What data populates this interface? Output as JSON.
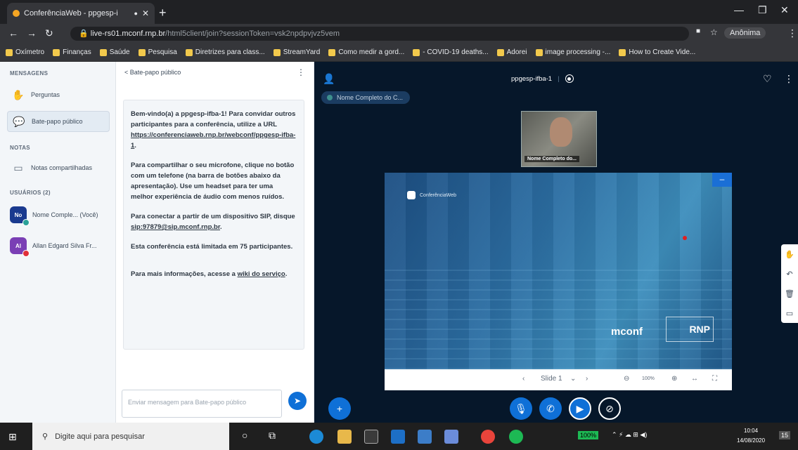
{
  "browser": {
    "tab_title": "ConferênciaWeb - ppgesp-i",
    "new_tab": "+",
    "url_host": "live-rs01.mconf.rnp.br",
    "url_path": "/html5client/join?sessionToken=vsk2npdpvjvz5vem",
    "profile": "Anônima",
    "bookmarks": [
      "Oxímetro",
      "Finanças",
      "Saúde",
      "Pesquisa",
      "Diretrizes para class...",
      "StreamYard",
      "Como medir a gord...",
      "- COVID-19 deaths...",
      "Adorei",
      "image processing -...",
      "How to Create Vide..."
    ]
  },
  "sidebar": {
    "messages_title": "MENSAGENS",
    "questions": "Perguntas",
    "public_chat": "Bate-papo público",
    "notes_title": "NOTAS",
    "shared_notes": "Notas compartilhadas",
    "users_title": "USUÁRIOS (2)",
    "users": [
      {
        "initials": "No",
        "name": "Nome Comple... (Você)",
        "color": "#1a3a8f",
        "status_color": "#2aa198"
      },
      {
        "initials": "Al",
        "name": "Allan Edgard Silva Fr...",
        "color": "#7a3fb5",
        "status_color": "#e0303a"
      }
    ]
  },
  "chat": {
    "header": "< Bate-papo público",
    "welcome_p1": "Bem-vindo(a) a ppgesp-ifba-1! Para convidar outros participantes para a conferência, utilize a URL",
    "welcome_url": "https://conferenciaweb.rnp.br/webconf/ppgesp-ifba-1",
    "welcome_p2": "Para compartilhar o seu microfone, clique no botão com um telefone (na barra de botões abaixo da apresentação). Use um headset para ter uma melhor experiência de áudio com menos ruídos.",
    "welcome_p3_prefix": "Para conectar a partir de um dispositivo SIP, disque",
    "welcome_sip": "sip:97879@sip.mconf.rnp.br",
    "welcome_p4": "Esta conferência está limitada em 75 participantes.",
    "welcome_p5_prefix": "Para mais informações, acesse a",
    "welcome_wiki": "wiki do serviço",
    "input_placeholder": "Enviar mensagem para Bate-papo público"
  },
  "conference": {
    "title": "ppgesp-ifba-1",
    "talker": "Nome Completo do C...",
    "webcam_label": "Nome Completo do...",
    "slide_brand": "ConferênciaWeb",
    "slide_mconf": "mconf",
    "slide_rnp": "RNP",
    "slide_label": "Slide 1",
    "zoom": "100%"
  },
  "taskbar": {
    "search_placeholder": "Digite aqui para pesquisar",
    "battery": "100%",
    "time": "10:04",
    "date": "14/08/2020",
    "notif_count": "15"
  }
}
